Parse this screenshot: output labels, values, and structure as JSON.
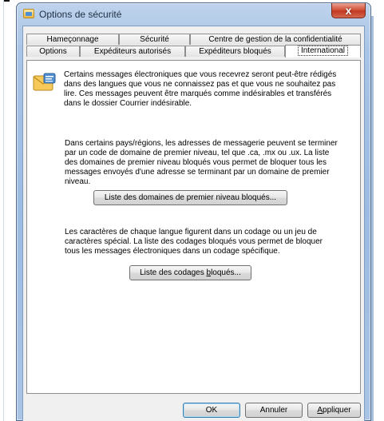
{
  "window": {
    "title": "Options de sécurité",
    "close_glyph": "x"
  },
  "tabs": {
    "row1": [
      {
        "label": "Hameçonnage"
      },
      {
        "label": "Sécurité"
      },
      {
        "label": "Centre de gestion de la confidentialité"
      }
    ],
    "row2": [
      {
        "label": "Options"
      },
      {
        "label": "Expéditeurs autorisés"
      },
      {
        "label": "Expéditeurs bloqués"
      },
      {
        "label": "International",
        "active": true
      }
    ]
  },
  "panel": {
    "intro_lines": [
      "Certains messages électroniques que vous recevrez seront peut-être rédigés",
      "dans des langues que vous ne connaissez pas et que vous ne souhaitez pas",
      "lire. Ces messages peuvent être marqués comme indésirables et transférés",
      "dans le dossier Courrier indésirable."
    ],
    "domains_lines": [
      "Dans certains pays/régions, les adresses de messagerie peuvent se terminer",
      "par un code de domaine de premier niveau, tel que .ca, .mx ou .ux. La liste",
      "des domaines de premier niveau bloqués vous permet de bloquer tous les",
      "messages envoyés d'une adresse se terminant par un domaine de premier",
      "niveau."
    ],
    "domains_button": "Liste des domaines de premier niveau bloqués...",
    "encodings_lines": [
      "Les caractères de chaque langue figurent dans un codage ou un jeu de",
      "caractères spécial. La liste des codages bloqués vous permet de bloquer",
      "tous les messages électroniques dans un codage spécifique."
    ],
    "encodings_button_pre": "Liste des codages ",
    "encodings_button_u": "b",
    "encodings_button_post": "loqués...",
    "icon": "safety-envelope-icon"
  },
  "footer": {
    "ok": "OK",
    "cancel": "Annuler",
    "apply_u": "A",
    "apply_rest": "ppliquer"
  }
}
